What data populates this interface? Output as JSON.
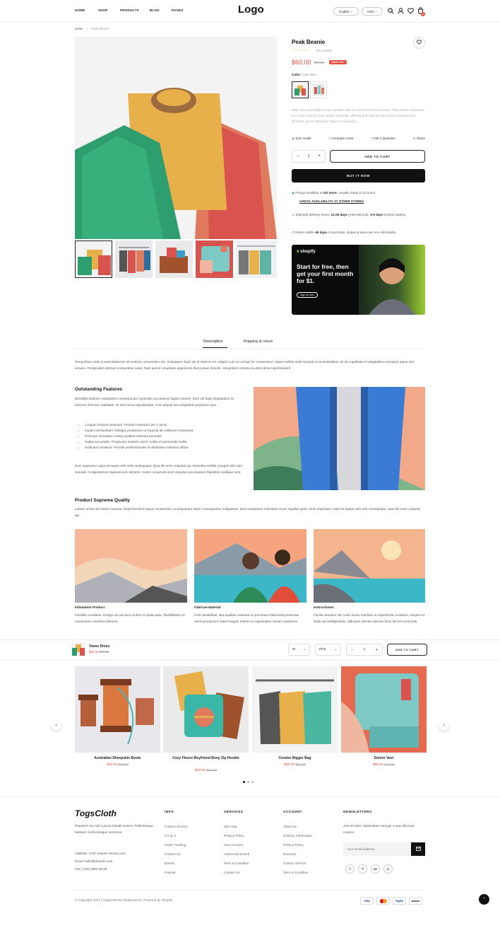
{
  "header": {
    "nav": [
      "HOME",
      "SHOP",
      "PRODUCTS",
      "BLOG",
      "PAGES"
    ],
    "logo": "Logo",
    "language": "English",
    "currency": "USD",
    "cart_count": "0"
  },
  "breadcrumb": {
    "home": "Home",
    "separator": "›",
    "current": "Peak Beanie"
  },
  "product": {
    "title": "Peak Beanie",
    "reviews": "No reviews",
    "price": "$60.00",
    "compare_price": "$70.00",
    "save_badge": "SAVE 14%",
    "color_label": "Color:",
    "color_value": "Dark Blue",
    "description": "Stay cozy and stylish in any weather with our [Product Name] beanie. This classic accessory is a must-have for your winter wardrobe, offering both warmth and fashion-forward flair. Whether you're hitting the slopes or braving t...",
    "links": [
      "Size Guide",
      "Compare Color",
      "Ask a Question",
      "Share"
    ],
    "quantity": "1",
    "add_to_cart": "ADD TO CART",
    "buy_now": "BUY IT NOW",
    "pickup_prefix": "Pickup available at",
    "pickup_store": "US store",
    "pickup_suffix": ". Usually ready in 24 hours",
    "check_availability": "CHECK AVAILABILITY AT OTHER STORES",
    "delivery_prefix": "Estimate delivery times:",
    "delivery_intl": "12-26 days",
    "delivery_mid": "(International),",
    "delivery_us": "3-6 days",
    "delivery_suffix": "(United States).",
    "return_prefix": "Return within",
    "return_days": "45 days",
    "return_suffix": "of purchase. Duties & taxes are non-refundable."
  },
  "banner": {
    "brand": "shopify",
    "headline": "Start for free, then get your first month for $1.",
    "cta": "Sign up now"
  },
  "tabs": [
    "Description",
    "Shipping & return"
  ],
  "description": {
    "intro": "Temporibus unde ut exercitationem sit nostrum consectetur est. Voluptatem fugit nisi et minima vel. Adipisci iure ut corrupti hic consectetur. Atque mollitia modi suscipit ut necessitatibus. Et ab cupiditate et voluptatibus excepturi atque sint veniam. Perspiciatis dolorum consectetur amet. Nam sed et voluptates asperiores illum ipsam deleniti. Voluptatem minima ex dolor dicta reprehenderit.",
    "features_title": "Outstanding Features",
    "features_intro": "Blanditiis dolorem voluptatem consequuntur explicabo accusamus fugiat maxime. Eum vel fugit voluptatibus ex dolorum dolorem cupiditate. Et sed minus repudiandae. Cum aliquid aut voluptatem possimus ipsa.",
    "bullets": [
      "Longum tempus varantum: Product varantum pro 2 annis.",
      "Impact resistentiam: Designs productum ut impacta ab collisione sustineant.",
      "Princeps retusatem: Using qualitas materias princeps.",
      "Notitia securitatis: Prospicere salutem users' notitia et personalis notitia",
      "Dedicavit ministros: Provide professionales et dedicatos ministros officia"
    ],
    "features_outro": "Eum asperiatur culpa sit saepe velit velit consequatur. Quia illo enim voluptas qui. Expedita mollitia suscipit odio nam suscipit. At dignissimos sapiente iure dolorem. Autem occaecati amet voluptas accusantium blanditiis similique sunt.",
    "quality_title": "Product Supreme Quality",
    "quality_text": "Labore omnis sint totam maxime. Reprehenderit eaque consectetur consequuntur ullam consequuntur voluptatum. Eius voluptatem molestias rerum repellat quam. Eum asperiatur culpa sit saepe velit velit consequatur. Quia illo enim voluptas qui.",
    "cards": [
      {
        "title": "Infomation Product",
        "text": "Flexibile consilium: Design res ad usus multos et spatia apta, flexibilitatem et commodum usoribus afferens."
      },
      {
        "title": "Fabricae Material",
        "text": "SAfe durabilitas: alta qualitas materiae et processus fabricandi prosectae utens productum habet longum restem et capacitatem bonam sustinens."
      },
      {
        "title": "Instructiones",
        "text": "Facilis utendum est: User-amica interface et experientia consilium, simplex et facile ad intelligendum, adiuvans utentes utentes facto facil et commoda."
      }
    ]
  },
  "sticky_bar": {
    "name": "Views Dress",
    "price": "$60.00",
    "compare_price": "$70.00",
    "size": "M",
    "color": "Pink",
    "quantity": "1",
    "add_to_cart": "ADD TO CART"
  },
  "related": [
    {
      "name": "Australian Sheepskin Boots",
      "price": "$60.00",
      "compare": "$70.00"
    },
    {
      "name": "Cozy Fleece Boyfriend Boxy Zip Hoodie",
      "price": "$60.00",
      "compare": "$70.00"
    },
    {
      "name": "Curator Bigger Bag",
      "price": "$60.00",
      "compare": "$70.00"
    },
    {
      "name": "Deniro Vest",
      "price": "$60.00",
      "compare": "$70.00"
    }
  ],
  "footer": {
    "brand": "TogsCloth",
    "about": "Praesent nec nisl a purus blandit viverra. Pellentesque habitant morbi tristique senectus.",
    "address": "Address: 1234 Heaven Stress,USA.",
    "email": "Email: hello@domain.com",
    "fax": "Fax: (+84) 1800 68 68",
    "info_title": "INFO",
    "info_links": [
      "Custom Service",
      "F.A.Q.'s",
      "Order Tracking",
      "Contact Us",
      "Events",
      "Popular"
    ],
    "services_title": "SERVICES",
    "services_links": [
      "Site map",
      "Privacy Policy",
      "Your Account",
      "Advanced Search",
      "Term & Condition",
      "Contact Us"
    ],
    "account_title": "ACCOUNT",
    "account_links": [
      "About Us",
      "Delivery Information",
      "Privacy Policy",
      "Discount",
      "Custom Service",
      "Term & Condition"
    ],
    "newsletter_title": "NEWSLETTERS",
    "newsletter_text": "Join 40.000+ Subscribers and get a new discount coupon",
    "email_placeholder": "Your email address...",
    "social": [
      "twitter",
      "pinterest",
      "behance",
      "instagram"
    ],
    "copyright": "© Copyright 2024 | TogsCloth By ShopiLaunch. Powered by Shopify.",
    "payments": [
      "VISA",
      "MC",
      "PayPal",
      "amazon"
    ]
  }
}
